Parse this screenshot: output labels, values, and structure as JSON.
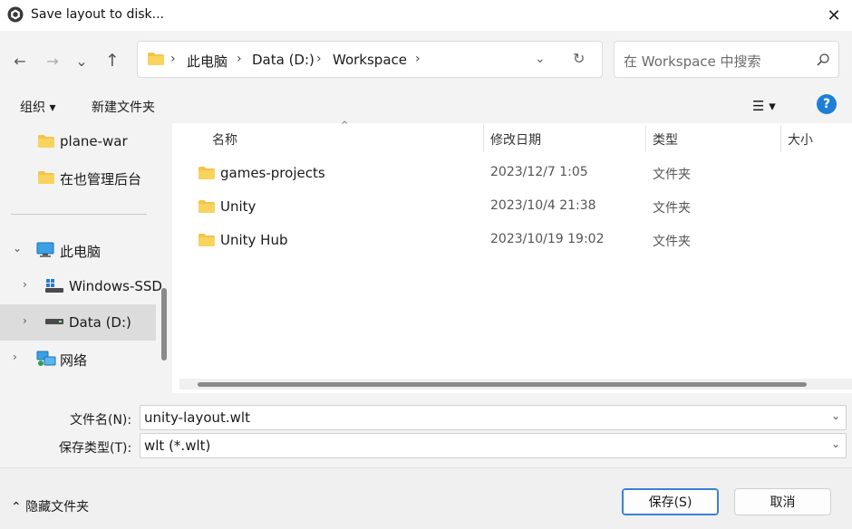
{
  "window": {
    "title": "Save layout to disk...",
    "close_glyph": "✕",
    "app_icon": "unity-icon"
  },
  "nav": {
    "back_glyph": "←",
    "forward_glyph": "→",
    "recent_glyph": "⌄",
    "up_glyph": "↑"
  },
  "address": {
    "crumbs": [
      "此电脑",
      "Data (D:)",
      "Workspace"
    ],
    "sep": "›",
    "dropdown_glyph": "⌄",
    "refresh_glyph": "↻"
  },
  "search": {
    "placeholder": "在 Workspace 中搜索"
  },
  "toolbar": {
    "organize": "组织 ▾",
    "new_folder": "新建文件夹",
    "view_glyph": "☰ ▾",
    "help_glyph": "?"
  },
  "sidebar": {
    "items": [
      {
        "label": "plane-war",
        "icon": "folder-icon"
      },
      {
        "label": "在也管理后台",
        "icon": "folder-icon"
      },
      {
        "label": "此电脑",
        "icon": "computer-icon",
        "chev": "⌄"
      },
      {
        "label": "Windows-SSD",
        "icon": "drive-icon",
        "chev": "›"
      },
      {
        "label": "Data (D:)",
        "icon": "drive-icon",
        "chev": "›"
      },
      {
        "label": "网络",
        "icon": "network-icon",
        "chev": "›"
      }
    ]
  },
  "files": {
    "columns": [
      "名称",
      "修改日期",
      "类型",
      "大小"
    ],
    "sort_glyph": "^",
    "rows": [
      {
        "name": "games-projects",
        "date": "2023/12/7 1:05",
        "type": "文件夹"
      },
      {
        "name": "Unity",
        "date": "2023/10/4 21:38",
        "type": "文件夹"
      },
      {
        "name": "Unity Hub",
        "date": "2023/10/19 19:02",
        "type": "文件夹"
      }
    ]
  },
  "save": {
    "filename_label": "文件名(N):",
    "filename_value": "unity-layout.wlt",
    "filetype_label": "保存类型(T):",
    "filetype_value": "wlt (*.wlt)",
    "dd_glyph": "⌄"
  },
  "footer": {
    "hide_folders": "⌃ 隐藏文件夹",
    "save_button": "保存(S)",
    "cancel_button": "取消"
  },
  "colors": {
    "folder": "#f3c447",
    "accent": "#1e7fd6"
  }
}
